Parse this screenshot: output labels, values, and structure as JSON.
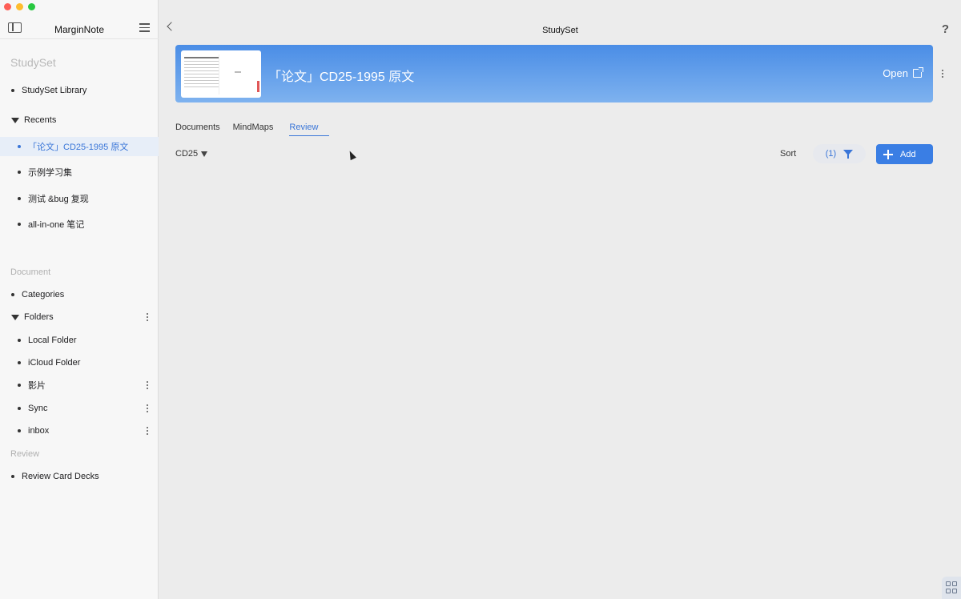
{
  "sidebar": {
    "app_title": "MarginNote",
    "studyset_section": "StudySet",
    "library": "StudySet Library",
    "recents": {
      "label": "Recents",
      "items": [
        "「论文」CD25-1995 原文",
        "示例学习集",
        "测试 &bug 复现",
        "all-in-one 笔记"
      ]
    },
    "document_section": "Document",
    "categories": "Categories",
    "folders": {
      "label": "Folders",
      "items": [
        "Local Folder",
        "iCloud Folder",
        "影片",
        "Sync",
        "inbox"
      ]
    },
    "review_section": "Review",
    "review_decks": "Review Card Decks"
  },
  "main": {
    "title": "StudySet",
    "help": "?",
    "banner": {
      "title": "「论文」CD25-1995 原文",
      "open_label": "Open"
    },
    "tabs": [
      "Documents",
      "MindMaps",
      "Review"
    ],
    "active_tab": "Review",
    "filter_value": "CD25",
    "sort_label": "Sort",
    "filter_count": "(1)",
    "add_label": "Add"
  },
  "colors": {
    "accent": "#3a76d8",
    "banner_gradient_top": "#4a8de6",
    "banner_gradient_bottom": "#7eb2ef"
  }
}
